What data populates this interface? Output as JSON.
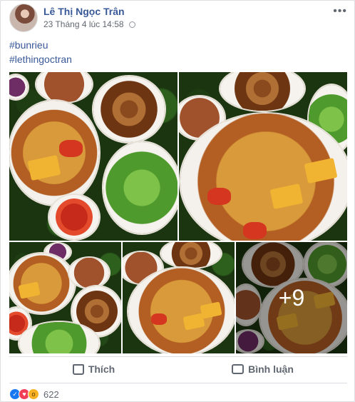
{
  "post": {
    "author": "Lê Thị Ngọc Trân",
    "timestamp": "23 Tháng 4 lúc 14:58",
    "more_label": "•••",
    "hashtags": [
      "#bunrieu",
      "#lethingoctran"
    ]
  },
  "photos": {
    "more_count": "+9"
  },
  "actions": {
    "like_label": "Thích",
    "comment_label": "Bình luận"
  },
  "reactions": {
    "icons": [
      "like-icon",
      "love-icon",
      "wow-icon"
    ],
    "count": "622"
  },
  "colors": {
    "link": "#385898",
    "secondary_text": "#616770",
    "like_blue": "#1877f2",
    "love_red": "#f33e58",
    "wow_yellow": "#f7b125"
  }
}
